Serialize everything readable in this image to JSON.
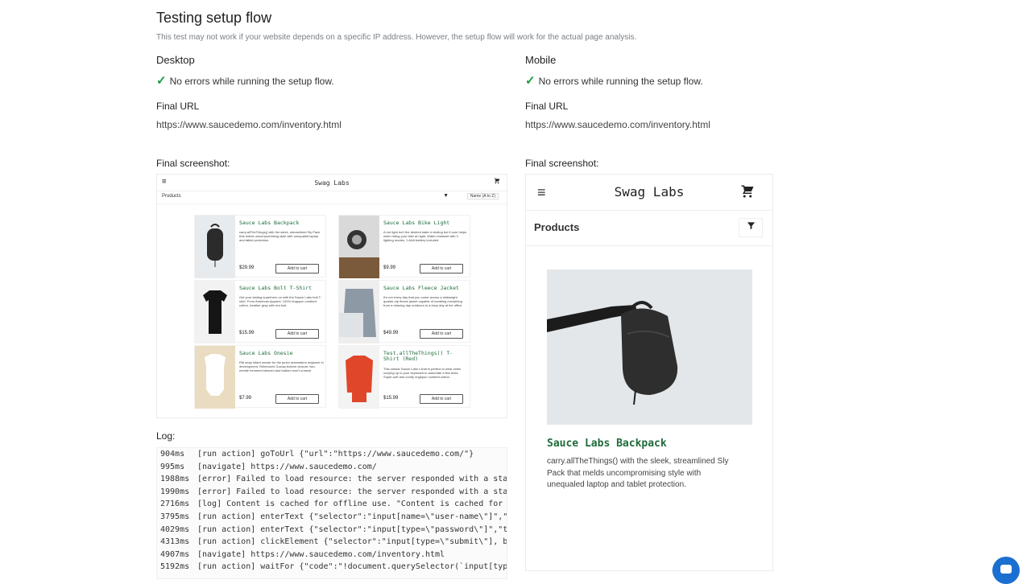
{
  "page": {
    "title": "Testing setup flow",
    "subtitle": "This test may not work if your website depends on a specific IP address. However, the setup flow will work for the actual page analysis."
  },
  "desktop": {
    "heading": "Desktop",
    "status": "No errors while running the setup flow.",
    "final_url_label": "Final URL",
    "final_url": "https://www.saucedemo.com/inventory.html",
    "screenshot_label": "Final screenshot:",
    "screenshot": {
      "brand": "Swag Labs",
      "section": "Products",
      "sort": "Name (A to Z)",
      "products": [
        {
          "name": "Sauce Labs Backpack",
          "desc": "carry.allTheThings() with the sleek, streamlined Sly Pack that melds uncompromising style with unequaled laptop and tablet protection.",
          "price": "$29.99",
          "button": "Add to cart"
        },
        {
          "name": "Sauce Labs Bike Light",
          "desc": "A red light isn't the desired state in testing but it sure helps when riding your bike at night. Water-resistant with 3 lighting modes, 1 AAA battery included.",
          "price": "$9.99",
          "button": "Add to cart"
        },
        {
          "name": "Sauce Labs Bolt T-Shirt",
          "desc": "Get your testing superhero on with the Sauce Labs bolt T-shirt. From American Apparel, 100% ringspun combed cotton, heather gray with red bolt.",
          "price": "$15.99",
          "button": "Add to cart"
        },
        {
          "name": "Sauce Labs Fleece Jacket",
          "desc": "It's not every day that you come across a midweight quarter-zip fleece jacket capable of handling everything from a relaxing day outdoors to a busy day at the office.",
          "price": "$49.99",
          "button": "Add to cart"
        },
        {
          "name": "Sauce Labs Onesie",
          "desc": "Rib snap infant onesie for the junior automation engineer in development. Reinforced 3-snap bottom closure, two-needle hemmed sleeved and bottom won't unravel.",
          "price": "$7.99",
          "button": "Add to cart"
        },
        {
          "name": "Test.allTheThings() T-Shirt (Red)",
          "desc": "This classic Sauce Labs t-shirt is perfect to wear when cozying up to your keyboard to automate a few tests. Super-soft and comfy ringspun combed cotton.",
          "price": "$15.99",
          "button": "Add to cart"
        }
      ]
    }
  },
  "mobile": {
    "heading": "Mobile",
    "status": "No errors while running the setup flow.",
    "final_url_label": "Final URL",
    "final_url": "https://www.saucedemo.com/inventory.html",
    "screenshot_label": "Final screenshot:",
    "screenshot": {
      "brand": "Swag Labs",
      "section": "Products",
      "product_name": "Sauce Labs Backpack",
      "product_desc": "carry.allTheThings() with the sleek, streamlined Sly Pack that melds uncompromising style with unequaled laptop and tablet protection."
    }
  },
  "log": {
    "label": "Log:",
    "entries": [
      {
        "t": "904ms",
        "msg": "[run action] goToUrl {\"url\":\"https://www.saucedemo.com/\"}"
      },
      {
        "t": "995ms",
        "msg": "[navigate] https://www.saucedemo.com/"
      },
      {
        "t": "1988ms",
        "msg": "[error] Failed to load resource: the server responded with a status"
      },
      {
        "t": "1990ms",
        "msg": "[error] Failed to load resource: the server responded with a status"
      },
      {
        "t": "2716ms",
        "msg": "[log] Content is cached for offline use. \"Content is cached for off"
      },
      {
        "t": "3795ms",
        "msg": "[run action] enterText {\"selector\":\"input[name=\\\"user-name\\\"]\",\"tex"
      },
      {
        "t": "4029ms",
        "msg": "[run action] enterText {\"selector\":\"input[type=\\\"password\\\"]\",\"text"
      },
      {
        "t": "4313ms",
        "msg": "[run action] clickElement {\"selector\":\"input[type=\\\"submit\\\"], butto"
      },
      {
        "t": "4907ms",
        "msg": "[navigate] https://www.saucedemo.com/inventory.html"
      },
      {
        "t": "5192ms",
        "msg": "[run action] waitFor {\"code\":\"!document.querySelector(`input[type=\\"
      }
    ]
  },
  "icons": {
    "check": "check-icon",
    "menu": "hamburger-menu-icon",
    "cart": "shopping-cart-icon",
    "filter": "filter-icon",
    "chat": "chat-bubble-icon"
  },
  "colors": {
    "check": "#1a9c3a",
    "product_name": "#1e6b3b",
    "chat": "#1b6fd0"
  }
}
